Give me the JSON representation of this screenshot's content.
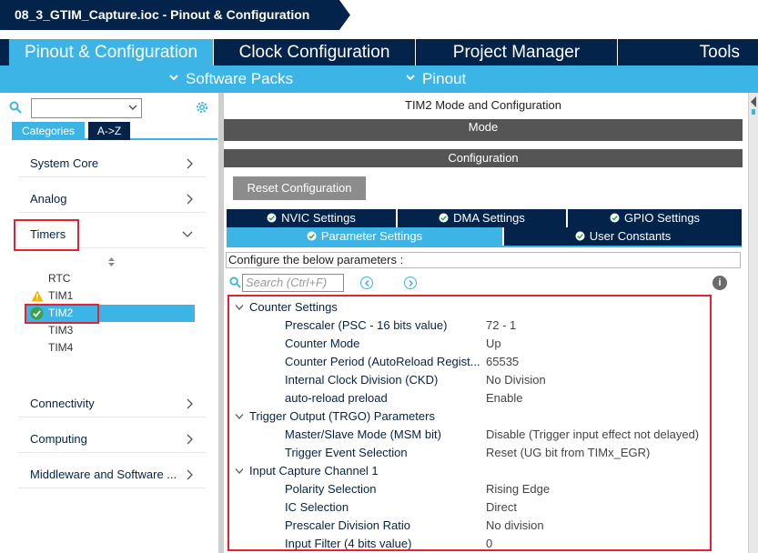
{
  "title": "08_3_GTIM_Capture.ioc - Pinout & Configuration",
  "tabs": [
    "Pinout & Configuration",
    "Clock Configuration",
    "Project Manager",
    "Tools"
  ],
  "subtabs": [
    "Software Packs",
    "Pinout"
  ],
  "left": {
    "category_tabs": [
      "Categories",
      "A->Z"
    ],
    "categories": [
      "System Core",
      "Analog",
      "Timers",
      "Connectivity",
      "Computing",
      "Middleware and Software ..."
    ],
    "timers": [
      "RTC",
      "TIM1",
      "TIM2",
      "TIM3",
      "TIM4"
    ]
  },
  "right": {
    "mode_title": "TIM2 Mode and Configuration",
    "mode_label": "Mode",
    "config_label": "Configuration",
    "reset_button": "Reset Configuration",
    "settings_tabs": [
      "NVIC Settings",
      "DMA Settings",
      "GPIO Settings",
      "Parameter Settings",
      "User Constants"
    ],
    "configure_label": "Configure the below parameters :",
    "search_placeholder": "Search (Ctrl+F)",
    "groups": [
      {
        "name": "Counter Settings",
        "params": [
          {
            "name": "Prescaler (PSC - 16 bits value)",
            "value": "72 - 1"
          },
          {
            "name": "Counter Mode",
            "value": "Up"
          },
          {
            "name": "Counter Period (AutoReload Regist...",
            "value": "65535"
          },
          {
            "name": "Internal Clock Division (CKD)",
            "value": "No Division"
          },
          {
            "name": "auto-reload preload",
            "value": "Enable"
          }
        ]
      },
      {
        "name": "Trigger Output (TRGO) Parameters",
        "params": [
          {
            "name": "Master/Slave Mode (MSM bit)",
            "value": "Disable (Trigger input effect not delayed)"
          },
          {
            "name": "Trigger Event Selection",
            "value": "Reset (UG bit from TIMx_EGR)"
          }
        ]
      },
      {
        "name": "Input Capture Channel 1",
        "params": [
          {
            "name": "Polarity Selection",
            "value": "Rising Edge"
          },
          {
            "name": "IC Selection",
            "value": "Direct"
          },
          {
            "name": "Prescaler Division Ratio",
            "value": "No division"
          },
          {
            "name": "Input Filter (4 bits value)",
            "value": "0"
          }
        ]
      }
    ]
  },
  "colors": {
    "navy": "#03234b",
    "accent": "#3cb4e6",
    "highlight_box": "#e52231",
    "warning": "#f5b400",
    "ok": "#3aa04b"
  }
}
